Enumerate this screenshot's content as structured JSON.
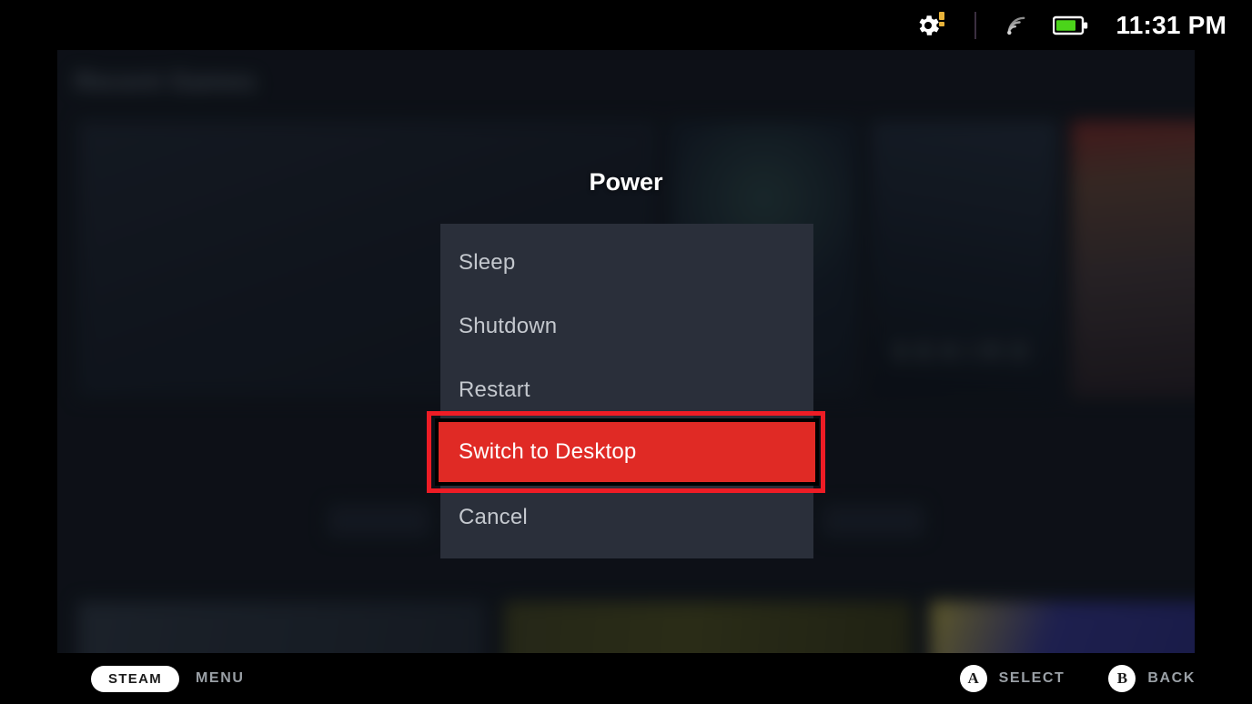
{
  "status_bar": {
    "gear_icon": "gear-icon",
    "gear_badge_color": "#e8b33a",
    "wifi_icon": "wifi-icon",
    "battery_icon": "battery-icon",
    "battery_color": "#4bd41a",
    "time": "11:31 PM"
  },
  "background": {
    "heading": "Recent Games",
    "subheading": "",
    "tiles_row1": [
      {
        "label": "",
        "title": "",
        "art_color": "#1d2330"
      },
      {
        "label": "",
        "title": "",
        "art_color": "#1a2331"
      },
      {
        "label": "",
        "title": "SEKIRO",
        "art_color": "#151d26"
      },
      {
        "label": "",
        "title": "",
        "art_color": "#3a1f23"
      }
    ],
    "buttons": [
      "",
      ""
    ],
    "tiles_row2": [
      {
        "label": "",
        "art_color": "#2b3440"
      },
      {
        "label": "",
        "art_color": "#3a3a1c"
      },
      {
        "label": "",
        "art_color": "#2b2f72"
      }
    ]
  },
  "dialog": {
    "title": "Power",
    "items": [
      {
        "label": "Sleep",
        "selected": false
      },
      {
        "label": "Shutdown",
        "selected": false
      },
      {
        "label": "Restart",
        "selected": false
      },
      {
        "label": "Switch to Desktop",
        "selected": true
      },
      {
        "label": "Cancel",
        "selected": false
      }
    ],
    "selected_label": "Switch to Desktop",
    "highlight_color": "#e02a25",
    "annotation_color": "#ee1c25",
    "panel_color": "#2a2f3a"
  },
  "bottom_bar": {
    "steam_pill": "STEAM",
    "steam_action": "MENU",
    "a_button": "A",
    "a_action": "SELECT",
    "b_button": "B",
    "b_action": "BACK"
  }
}
